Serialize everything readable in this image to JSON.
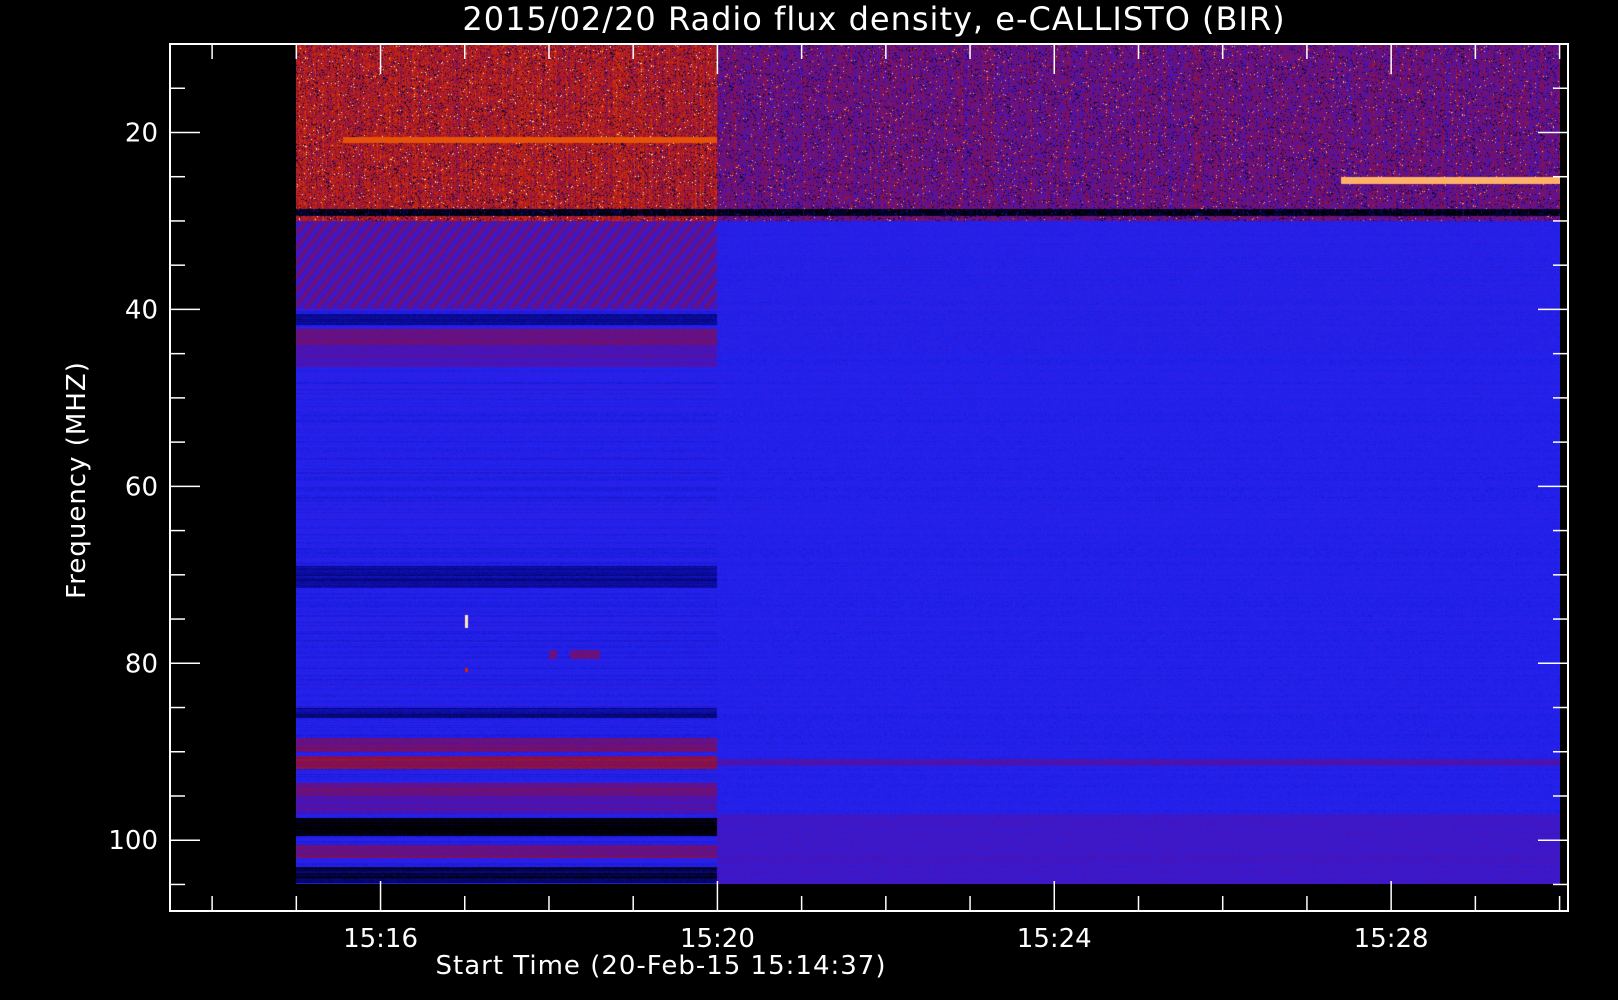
{
  "chart_data": {
    "type": "heatmap",
    "title": "2015/02/20  Radio flux density, e-CALLISTO (BIR)",
    "xlabel": "Start Time (20-Feb-15 15:14:37)",
    "ylabel": "Frequency (MHZ)",
    "x_unit": "UT time (minutes after 15:00)",
    "xlim": [
      13.5,
      30.1
    ],
    "ylim": [
      10,
      108
    ],
    "y_inverted": true,
    "data_extent": {
      "x": [
        15.0,
        30.0
      ],
      "y": [
        10,
        105
      ]
    },
    "x_ticks": [
      {
        "value": 16,
        "label": "15:16"
      },
      {
        "value": 20,
        "label": "15:20"
      },
      {
        "value": 24,
        "label": "15:24"
      },
      {
        "value": 28,
        "label": "15:28"
      }
    ],
    "y_ticks": [
      {
        "value": 20,
        "label": "20"
      },
      {
        "value": 40,
        "label": "40"
      },
      {
        "value": 60,
        "label": "60"
      },
      {
        "value": 80,
        "label": "80"
      },
      {
        "value": 100,
        "label": "100"
      }
    ],
    "x_minor_step": 1,
    "y_minor_step": 5,
    "colormap": [
      "#000000",
      "#0a0aa0",
      "#2323f2",
      "#4a12b4",
      "#8a1046",
      "#d02800",
      "#ff7a10",
      "#ffe8c0"
    ],
    "background_color": "#000000",
    "regions": [
      {
        "x": [
          15.0,
          30.0
        ],
        "y": [
          10,
          30
        ],
        "level": 4,
        "noise": "bursty"
      },
      {
        "x": [
          15.0,
          20.0
        ],
        "y": [
          10,
          30
        ],
        "level": 5,
        "noise": "bursty"
      },
      {
        "x": [
          15.0,
          20.0
        ],
        "y": [
          30,
          40
        ],
        "level": 3.5,
        "noise": "striped"
      },
      {
        "x": [
          20.0,
          30.0
        ],
        "y": [
          30,
          105
        ],
        "level": 2,
        "noise": "fine"
      },
      {
        "x": [
          15.0,
          20.0
        ],
        "y": [
          40,
          105
        ],
        "level": 2,
        "noise": "banded"
      }
    ],
    "bands": [
      {
        "x": [
          15.0,
          20.0
        ],
        "y": [
          40.5,
          41.8
        ],
        "level": 1
      },
      {
        "x": [
          15.0,
          20.0
        ],
        "y": [
          42.2,
          44.0
        ],
        "level": 3.5
      },
      {
        "x": [
          15.0,
          20.0
        ],
        "y": [
          44.0,
          46.5
        ],
        "level": 3
      },
      {
        "x": [
          15.0,
          20.0
        ],
        "y": [
          69.0,
          71.5
        ],
        "level": 1
      },
      {
        "x": [
          15.0,
          20.0
        ],
        "y": [
          85.0,
          86.2
        ],
        "level": 1
      },
      {
        "x": [
          15.0,
          20.0
        ],
        "y": [
          88.5,
          90.0
        ],
        "level": 3.5
      },
      {
        "x": [
          15.0,
          20.0
        ],
        "y": [
          90.5,
          92.0
        ],
        "level": 4
      },
      {
        "x": [
          15.0,
          20.0
        ],
        "y": [
          93.5,
          95.0
        ],
        "level": 3.5
      },
      {
        "x": [
          15.0,
          20.0
        ],
        "y": [
          95.0,
          97.0
        ],
        "level": 3
      },
      {
        "x": [
          15.0,
          20.0
        ],
        "y": [
          97.5,
          99.5
        ],
        "level": 0
      },
      {
        "x": [
          15.0,
          20.0
        ],
        "y": [
          100.5,
          102.0
        ],
        "level": 3.5
      },
      {
        "x": [
          15.0,
          20.0
        ],
        "y": [
          103.0,
          104.8
        ],
        "level": 0.5
      },
      {
        "x": [
          20.0,
          30.0
        ],
        "y": [
          90.8,
          91.6
        ],
        "level": 3
      },
      {
        "x": [
          20.0,
          30.0
        ],
        "y": [
          97.0,
          105
        ],
        "level": 2.7
      },
      {
        "x": [
          15.0,
          30.0
        ],
        "y": [
          28.6,
          29.4
        ],
        "level": 0.5
      }
    ],
    "highlights": [
      {
        "x": [
          15.55,
          20.0
        ],
        "y": [
          20.5,
          21.2
        ],
        "level": 5.5
      },
      {
        "x": [
          27.4,
          30.0
        ],
        "y": [
          25.0,
          25.8
        ],
        "level": 6.5
      },
      {
        "x": [
          17.0,
          17.04
        ],
        "y": [
          74.5,
          76.0
        ],
        "level": 7
      },
      {
        "x": [
          17.0,
          17.04
        ],
        "y": [
          80.5,
          81.0
        ],
        "level": 5
      },
      {
        "x": [
          18.0,
          18.1
        ],
        "y": [
          78.5,
          79.5
        ],
        "level": 3.5
      },
      {
        "x": [
          18.25,
          18.6
        ],
        "y": [
          78.5,
          79.5
        ],
        "level": 3.5
      }
    ]
  }
}
